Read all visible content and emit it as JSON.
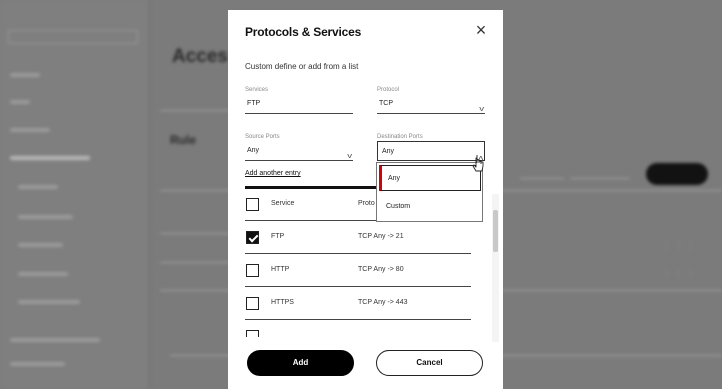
{
  "background": {
    "title": "Acces",
    "rule_heading": "Rule"
  },
  "modal": {
    "title": "Protocols & Services",
    "subtitle": "Custom define or add from a list",
    "services": {
      "label": "Services",
      "value": "FTP"
    },
    "protocol": {
      "label": "Protocol",
      "value": "TCP"
    },
    "source_ports": {
      "label": "Source Ports",
      "value": "Any"
    },
    "destination_ports": {
      "label": "Destination Ports",
      "value": "Any",
      "options": [
        "Any",
        "Custom"
      ],
      "selected": "Any"
    },
    "add_another": "Add another entry",
    "table": {
      "header": {
        "service": "Service",
        "protocol": "Proto"
      },
      "rows": [
        {
          "name": "FTP",
          "detail": "TCP Any -> 21",
          "checked": true
        },
        {
          "name": "HTTP",
          "detail": "TCP Any -> 80",
          "checked": false
        },
        {
          "name": "HTTPS",
          "detail": "TCP Any -> 443",
          "checked": false
        }
      ]
    },
    "add_button": "Add",
    "cancel_button": "Cancel"
  },
  "colors": {
    "accent": "#cd040b",
    "primary": "#000000",
    "overlay": "#7b7b7b"
  }
}
